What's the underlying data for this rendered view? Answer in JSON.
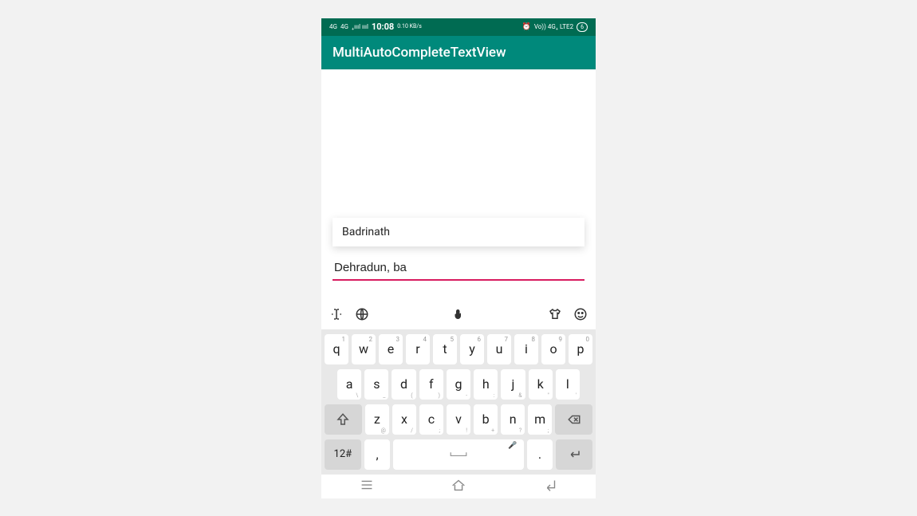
{
  "status": {
    "signal1": "4G",
    "signal2": "4G",
    "bars": "₊ıııl ıııl",
    "time": "10:08",
    "kbs": "0.10 KB/s",
    "alarm": "⏰",
    "volte": "Vo)) 4G₊ LTE2",
    "battery": "6"
  },
  "app": {
    "title": "MultiAutoCompleteTextView"
  },
  "suggestion": {
    "text": "Badrinath"
  },
  "input": {
    "value": "Dehradun, ba"
  },
  "keyboard": {
    "row1": [
      {
        "k": "q",
        "a": "1"
      },
      {
        "k": "w",
        "a": "2"
      },
      {
        "k": "e",
        "a": "3"
      },
      {
        "k": "r",
        "a": "4"
      },
      {
        "k": "t",
        "a": "5"
      },
      {
        "k": "y",
        "a": "6"
      },
      {
        "k": "u",
        "a": "7"
      },
      {
        "k": "i",
        "a": "8"
      },
      {
        "k": "o",
        "a": "9"
      },
      {
        "k": "p",
        "a": "0"
      }
    ],
    "row2": [
      {
        "k": "a",
        "s": "\\"
      },
      {
        "k": "s",
        "s": "_"
      },
      {
        "k": "d",
        "s": "("
      },
      {
        "k": "f",
        "s": ")"
      },
      {
        "k": "g",
        "s": "-"
      },
      {
        "k": "h",
        "s": ":"
      },
      {
        "k": "j",
        "s": "&"
      },
      {
        "k": "k",
        "s": "\""
      },
      {
        "k": "l",
        "s": "'"
      }
    ],
    "row3": [
      {
        "k": "z",
        "s": "@"
      },
      {
        "k": "x",
        "s": "/"
      },
      {
        "k": "c",
        "s": ";"
      },
      {
        "k": "v",
        "s": "!"
      },
      {
        "k": "b",
        "s": "+"
      },
      {
        "k": "n",
        "s": "?"
      },
      {
        "k": "m",
        "s": ";"
      }
    ],
    "sym": "12#",
    "comma": ",",
    "period": "."
  }
}
